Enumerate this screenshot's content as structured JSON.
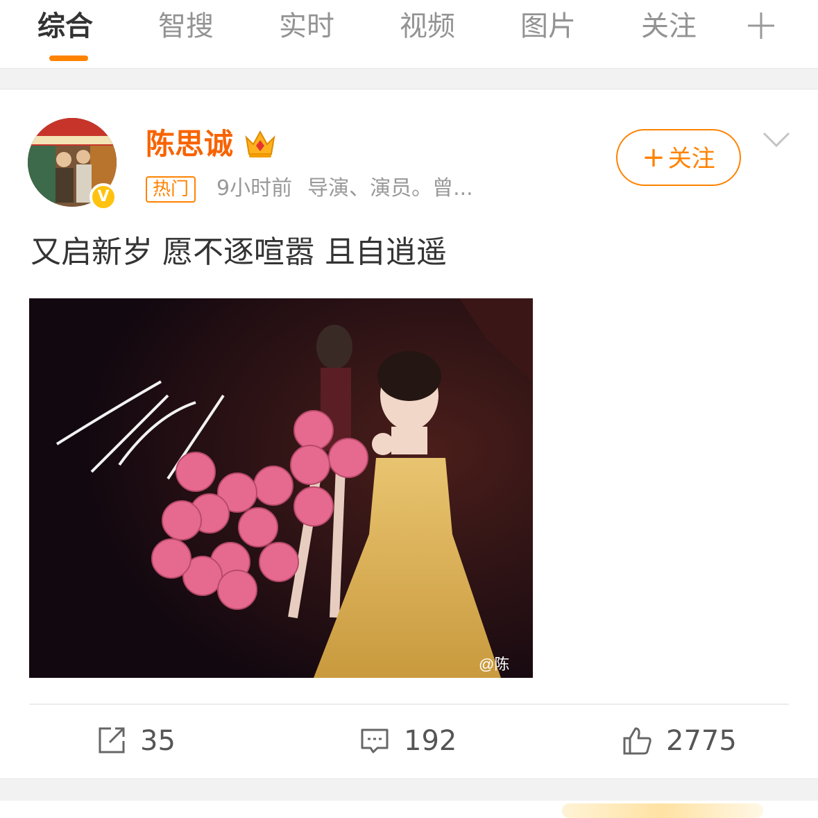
{
  "tabs": [
    {
      "label": "综合",
      "active": true
    },
    {
      "label": "智搜",
      "active": false
    },
    {
      "label": "实时",
      "active": false
    },
    {
      "label": "视频",
      "active": false
    },
    {
      "label": "图片",
      "active": false
    },
    {
      "label": "关注",
      "active": false
    }
  ],
  "colors": {
    "accent": "#ff8200",
    "username": "#f86300",
    "verified": "#ffc20e"
  },
  "post": {
    "username": "陈思诚",
    "hot_label": "热门",
    "time": "9小时前",
    "description": "导演、演员。曾...",
    "follow_label": "关注",
    "text": "又启新岁 愿不逐喧嚣 且自逍遥",
    "image_watermark": "@陈",
    "verified_mark": "V"
  },
  "actions": {
    "repost_count": "35",
    "comment_count": "192",
    "like_count": "2775"
  },
  "icons": [
    "plus-icon",
    "crown-icon",
    "verified-icon",
    "chevron-down-icon",
    "repost-icon",
    "comment-icon",
    "like-icon"
  ]
}
